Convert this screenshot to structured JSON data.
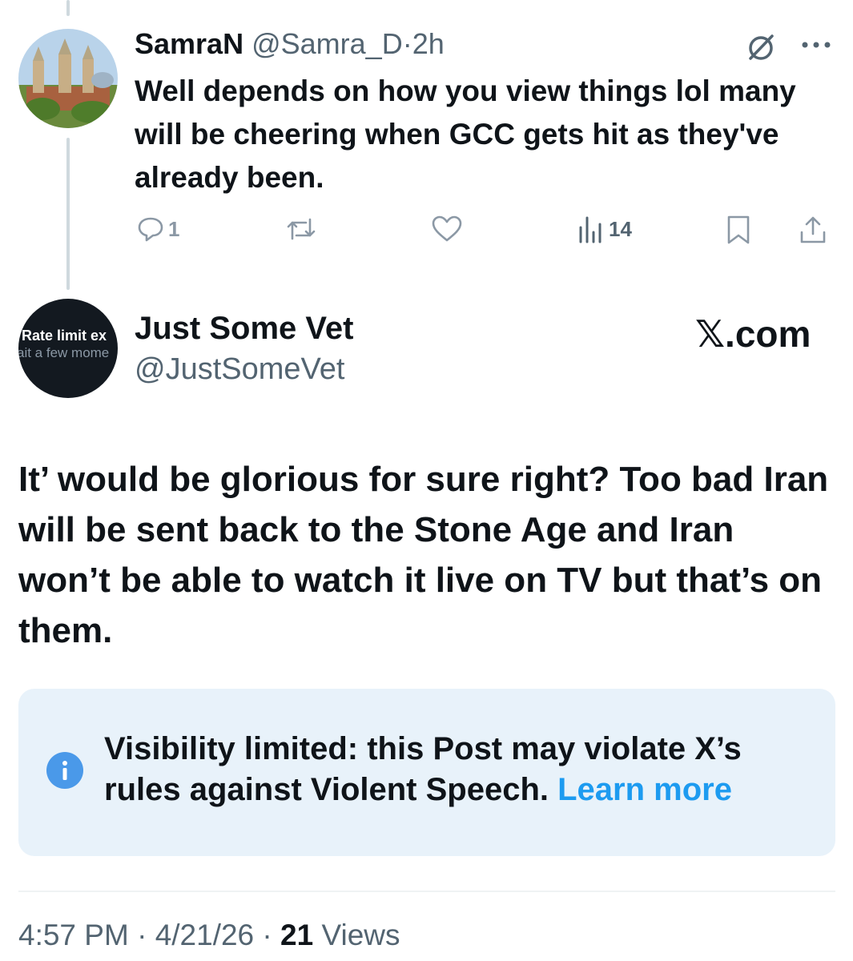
{
  "reply": {
    "name": "SamraN",
    "handle": "@Samra_D",
    "separator": "·",
    "time": "2h",
    "text": "Well depends on how you view things lol many will be cheering when GCC gets hit as they've already been.",
    "reply_count": "1",
    "view_count": "14"
  },
  "main": {
    "avatar_line1": "Rate limit ex",
    "avatar_line2": "ait a few mome",
    "name": "Just Some Vet",
    "handle": "@JustSomeVet",
    "brand": "𝕏.com",
    "text": "It’ would be glorious for sure right? Too bad Iran will be sent back to the Stone Age and Iran won’t be able to watch it live on TV but that’s on them."
  },
  "notice": {
    "text": "Visibility limited: this Post may violate X’s rules against Violent Speech.",
    "link": "Learn more"
  },
  "footer": {
    "time": "4:57 PM",
    "sep1": "·",
    "date": "4/21/26",
    "sep2": "·",
    "views_num": "21",
    "views_label": "Views"
  },
  "colors": {
    "link": "#1d9bf0",
    "muted": "#536471",
    "notice_bg": "#e8f2fa"
  },
  "icons": {
    "reply": "reply-icon",
    "repost": "repost-icon",
    "like": "heart-icon",
    "views": "views-icon",
    "bookmark": "bookmark-icon",
    "share": "share-icon",
    "grok": "grok-icon",
    "more": "more-icon",
    "info": "info-icon"
  }
}
